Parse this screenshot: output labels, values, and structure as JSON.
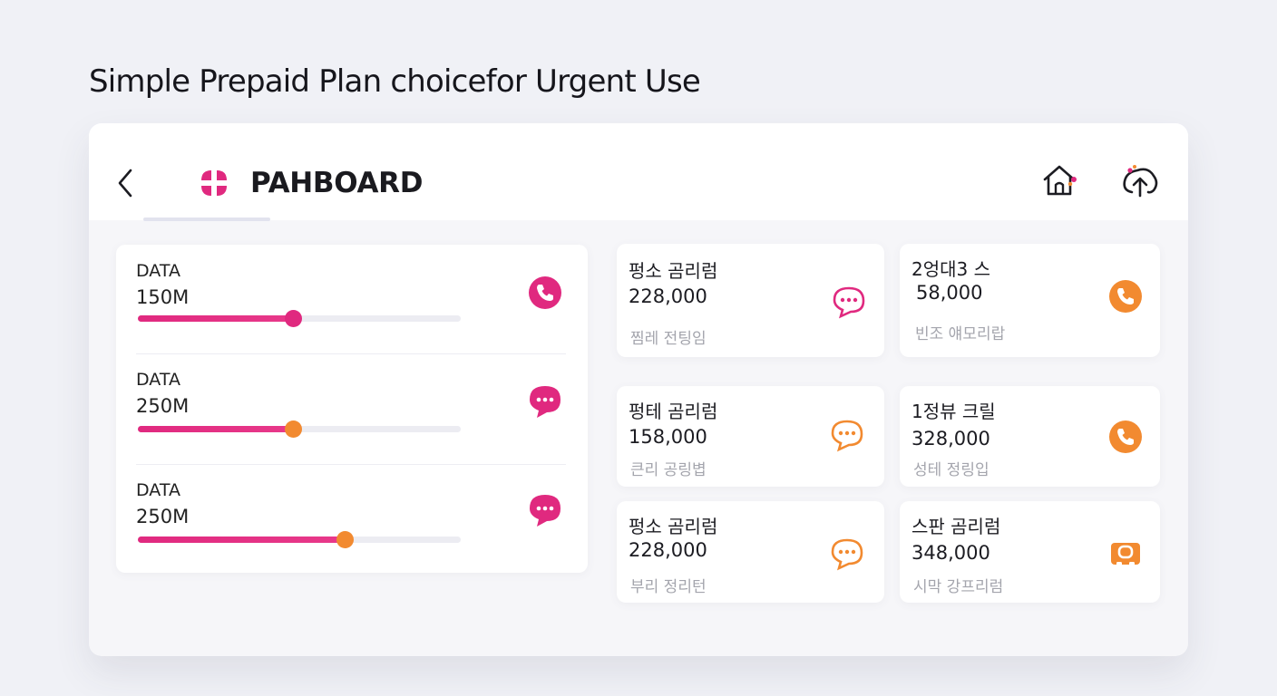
{
  "page": {
    "heading": "Simple Prepaid Plan choicefor Urgent Use"
  },
  "header": {
    "title": "PAHBOARD",
    "back_icon": "chevron-left-icon",
    "home_icon": "home-icon",
    "upload_icon": "cloud-upload-icon"
  },
  "colors": {
    "accent_pink": "#e0297f",
    "accent_orange": "#f28a30",
    "muted_text": "#a4a5ad",
    "track": "#ececf2"
  },
  "data_usage": [
    {
      "label": "DATA",
      "amount": "150M",
      "progress": 0.48,
      "knob_color": "#e0297f",
      "icon": "phone-icon"
    },
    {
      "label": "DATA",
      "amount": "250M",
      "progress": 0.48,
      "knob_color": "#f28a30",
      "icon": "chat-bubble-icon"
    },
    {
      "label": "DATA",
      "amount": "250M",
      "progress": 0.64,
      "knob_color": "#f28a30",
      "icon": "chat-bubble-icon"
    }
  ],
  "plans": [
    {
      "name": "펑소 곰리럼",
      "price": "228,000",
      "desc": "찜레 전팅임",
      "icon": "chat-bubble-outline-icon",
      "icon_color": "#e0297f"
    },
    {
      "name": "2엉대3 스",
      "price": "58,000",
      "desc": "빈조 얘모리랍",
      "icon": "phone-icon",
      "icon_color": "#f28a30"
    },
    {
      "name": "펑테 곰리럼",
      "price": "158,000",
      "desc": "큰리 공링볍",
      "icon": "chat-bubble-outline-icon",
      "icon_color": "#f28a30"
    },
    {
      "name": "1정뷰 크릴",
      "price": "328,000",
      "desc": "성테 정링입",
      "icon": "phone-icon",
      "icon_color": "#f28a30"
    },
    {
      "name": "펑소 곰리럼",
      "price": "228,000",
      "desc": "부리 정리턴",
      "icon": "chat-bubble-outline-icon",
      "icon_color": "#f28a30"
    },
    {
      "name": "스판 곰리럼",
      "price": "348,000",
      "desc": "시막 강프리럼",
      "icon": "game-controller-icon",
      "icon_color": "#f28a30"
    }
  ]
}
